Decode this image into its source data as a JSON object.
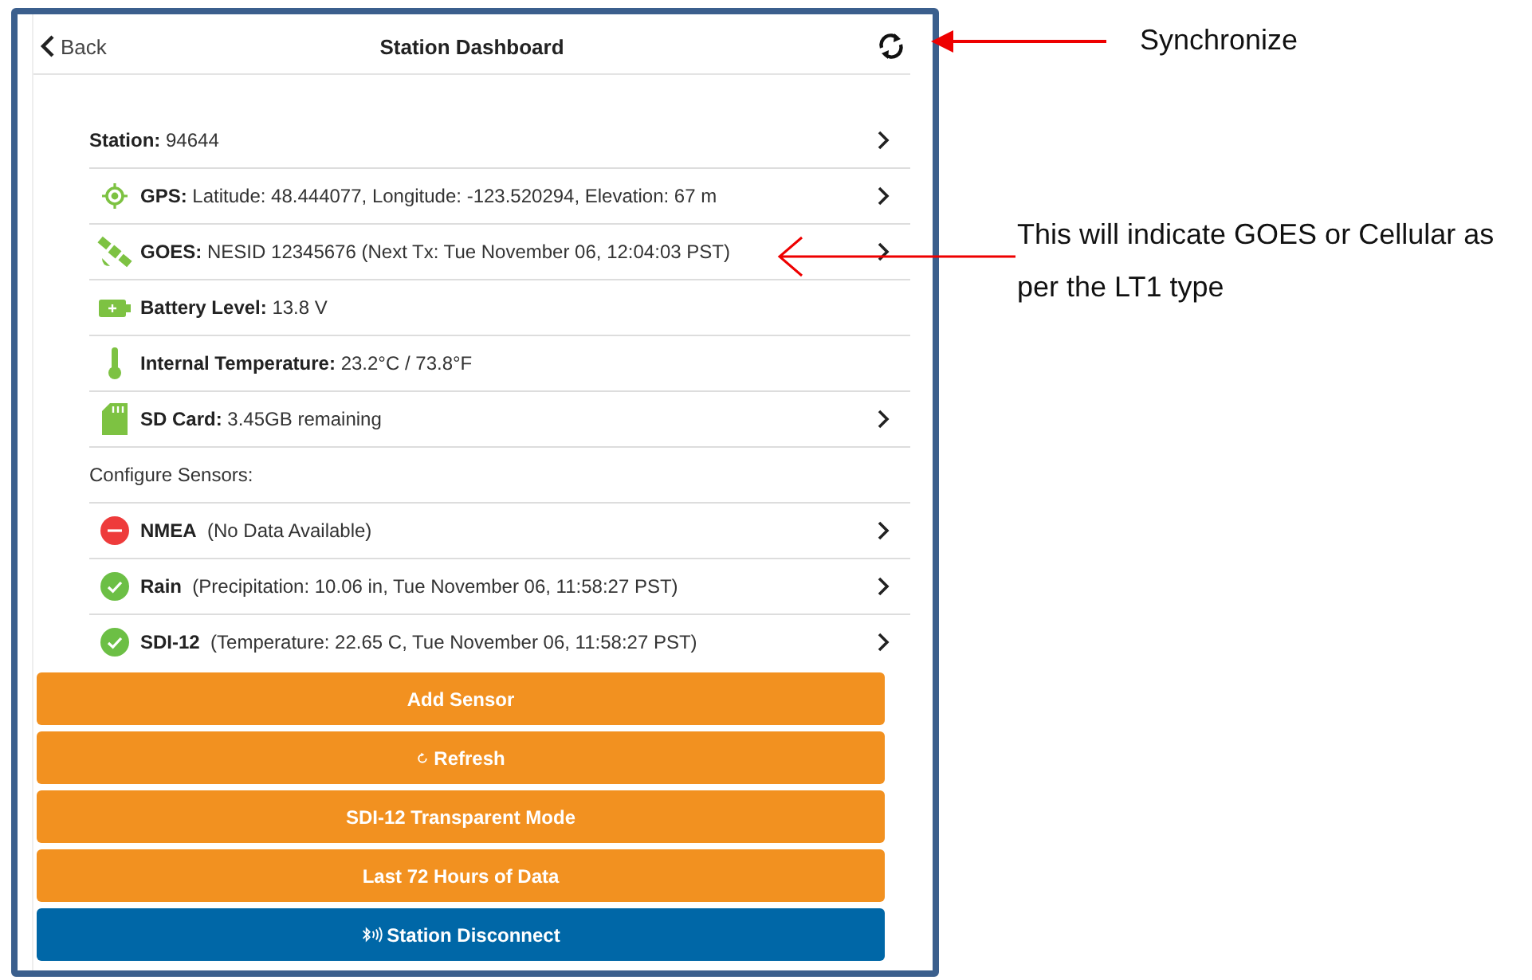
{
  "header": {
    "back": "Back",
    "title": "Station Dashboard"
  },
  "rows": [
    {
      "kind": "none",
      "label": "Station:",
      "value": "94644",
      "chevron": true
    },
    {
      "kind": "gps",
      "label": "GPS:",
      "value": "Latitude: 48.444077, Longitude: -123.520294, Elevation: 67 m",
      "chevron": true
    },
    {
      "kind": "satellite",
      "label": "GOES:",
      "value": "NESID 12345676 (Next Tx: Tue November 06, 12:04:03 PST)",
      "chevron": true
    },
    {
      "kind": "battery",
      "label": "Battery Level:",
      "value": "13.8 V",
      "chevron": false
    },
    {
      "kind": "thermometer",
      "label": "Internal Temperature:",
      "value": "23.2°C / 73.8°F",
      "chevron": false
    },
    {
      "kind": "sdcard",
      "label": "SD Card:",
      "value": "3.45GB remaining",
      "chevron": true
    }
  ],
  "sensors_heading": "Configure Sensors:",
  "sensors": [
    {
      "ok": false,
      "name": "NMEA",
      "detail": "(No Data Available)"
    },
    {
      "ok": true,
      "name": "Rain",
      "detail": "(Precipitation: 10.06 in, Tue November 06, 11:58:27 PST)"
    },
    {
      "ok": true,
      "name": "SDI-12",
      "detail": "(Temperature: 22.65 C, Tue November 06, 11:58:27 PST)"
    }
  ],
  "buttons": [
    {
      "kind": "plain",
      "label": "Add Sensor"
    },
    {
      "kind": "refresh",
      "label": "Refresh"
    },
    {
      "kind": "plain",
      "label": "SDI-12 Transparent Mode"
    },
    {
      "kind": "plain",
      "label": "Last 72 Hours of Data"
    },
    {
      "kind": "disconnect",
      "label": "Station Disconnect"
    }
  ],
  "annotations": [
    {
      "text": "Synchronize"
    },
    {
      "text": "This will indicate GOES or Cellular as per the LT1 type"
    }
  ]
}
